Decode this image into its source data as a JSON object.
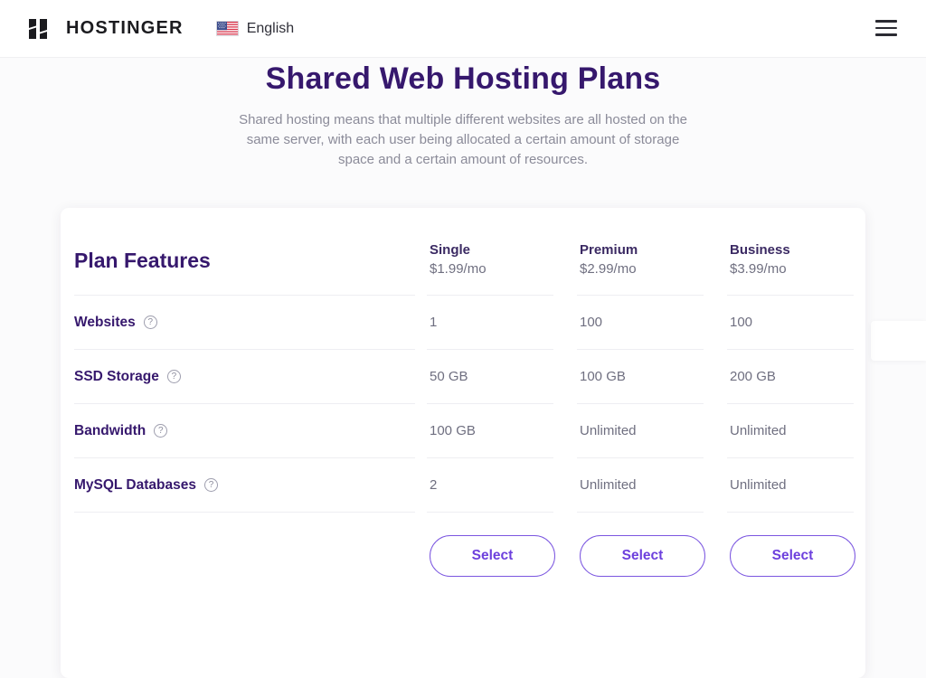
{
  "header": {
    "brand_name": "HOSTINGER",
    "logo_icon": "hostinger-h-logo",
    "language": {
      "flag_icon": "us-flag-icon",
      "label": "English"
    },
    "menu_icon": "hamburger-menu-icon"
  },
  "hero": {
    "title": "Shared Web Hosting Plans",
    "subtitle": "Shared hosting means that multiple different websites are all hosted on the same server, with each user being allocated a certain amount of storage space and a certain amount of resources."
  },
  "plans_table": {
    "features_heading": "Plan Features",
    "help_icon": "question-mark-circle-icon",
    "plans": [
      {
        "name": "Single",
        "price": "$1.99/mo",
        "cta": "Select"
      },
      {
        "name": "Premium",
        "price": "$2.99/mo",
        "cta": "Select"
      },
      {
        "name": "Business",
        "price": "$3.99/mo",
        "cta": "Select"
      }
    ],
    "features": [
      {
        "label": "Websites",
        "values": [
          "1",
          "100",
          "100"
        ]
      },
      {
        "label": "SSD Storage",
        "values": [
          "50 GB",
          "100 GB",
          "200 GB"
        ]
      },
      {
        "label": "Bandwidth",
        "values": [
          "100 GB",
          "Unlimited",
          "Unlimited"
        ]
      },
      {
        "label": "MySQL Databases",
        "values": [
          "2",
          "Unlimited",
          "Unlimited"
        ]
      }
    ]
  },
  "colors": {
    "brand_purple": "#36186d",
    "accent_purple": "#6d40dd",
    "muted_text": "#6f6f80",
    "page_bg": "#fbfbfc"
  }
}
